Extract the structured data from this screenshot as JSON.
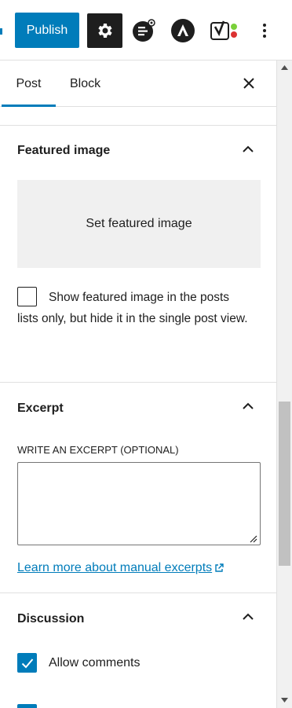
{
  "toolbar": {
    "publish_label": "Publish",
    "settings_icon": "gear-icon",
    "plugin_icons": [
      "editorskit-icon",
      "astra-icon",
      "yoast-seo-icon"
    ],
    "more_icon": "more-vertical-icon",
    "accent_color": "#007cba"
  },
  "sidebar": {
    "tabs": [
      {
        "label": "Post",
        "active": true
      },
      {
        "label": "Block",
        "active": false
      }
    ],
    "close_icon": "close-icon"
  },
  "featured_image": {
    "title": "Featured image",
    "set_label": "Set featured image",
    "checkbox_text": "Show featured image in the posts lists only, but hide it in the single post view.",
    "checkbox_checked": false
  },
  "excerpt": {
    "title": "Excerpt",
    "field_label": "WRITE AN EXCERPT (OPTIONAL)",
    "value": "",
    "learn_more": "Learn more about manual excerpts"
  },
  "discussion": {
    "title": "Discussion",
    "allow_comments_label": "Allow comments",
    "allow_comments_checked": true
  }
}
